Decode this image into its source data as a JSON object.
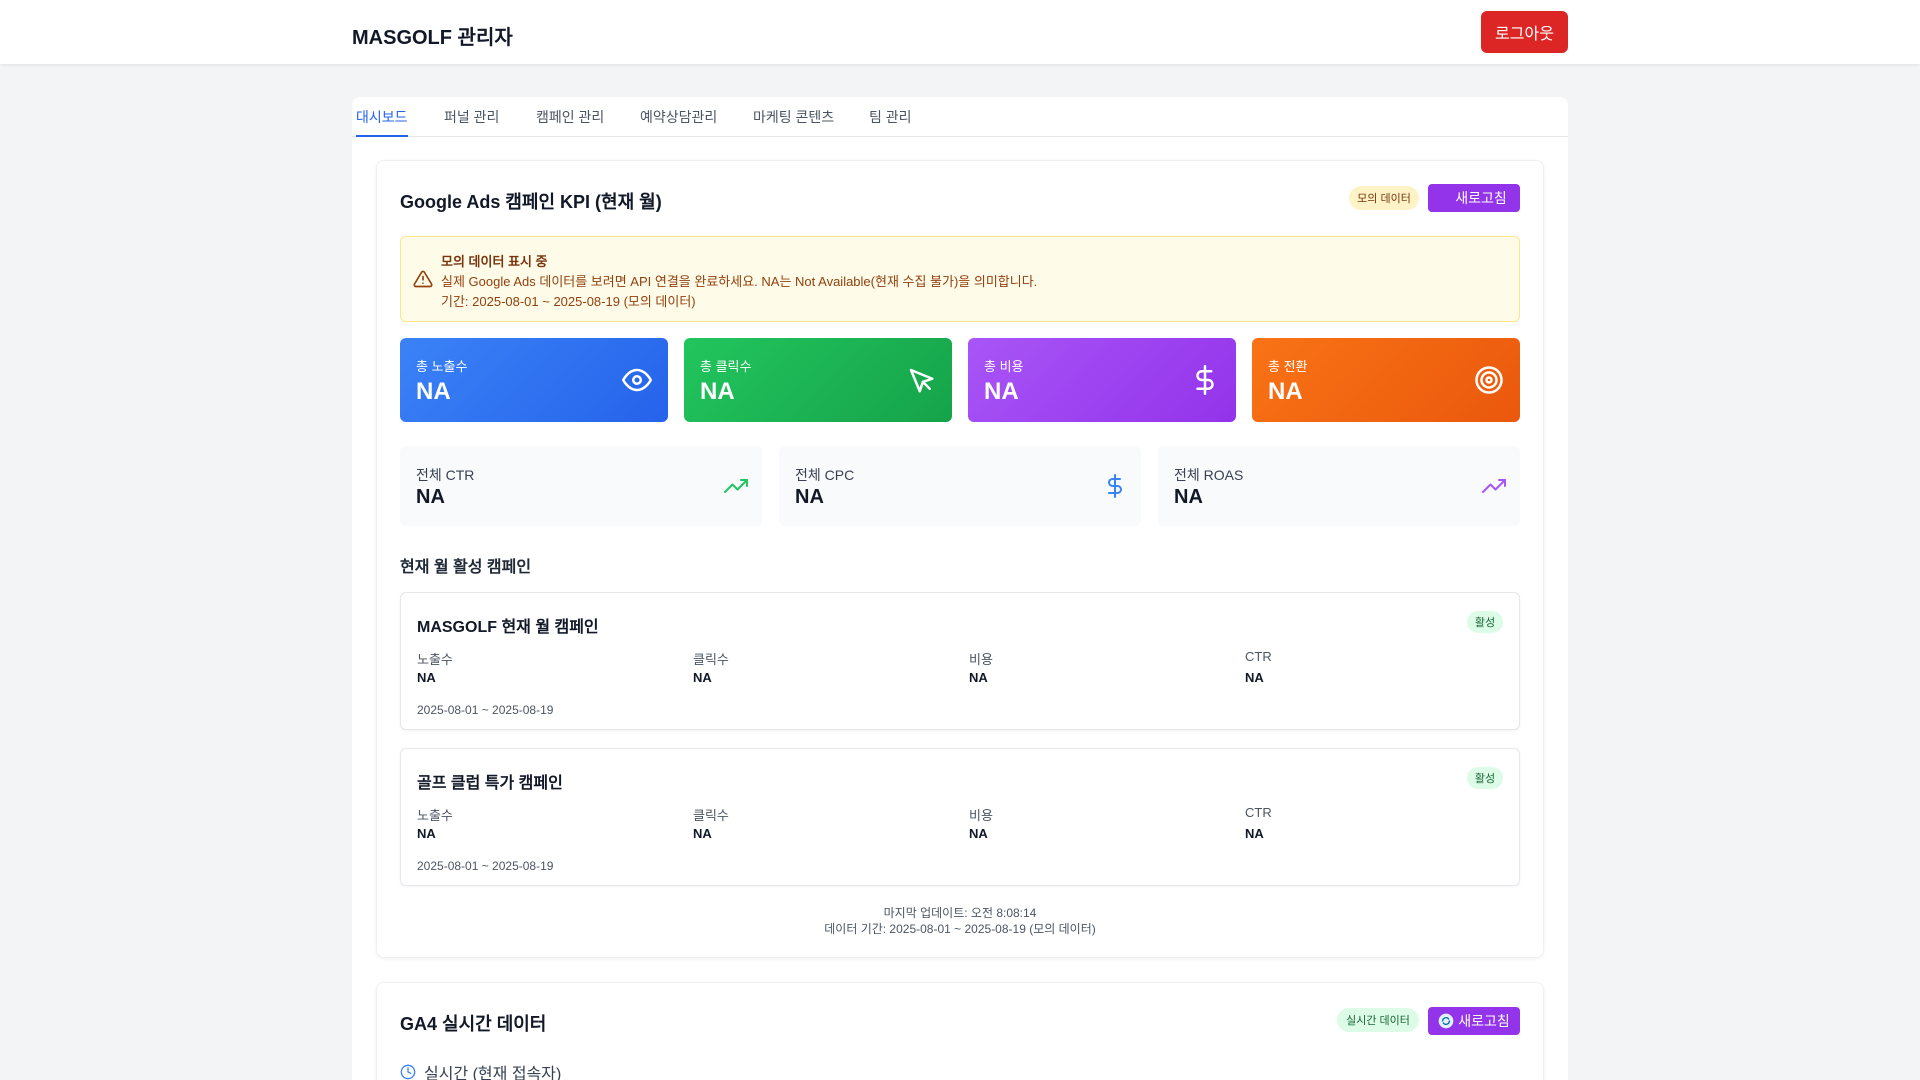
{
  "header": {
    "brand": "MASGOLF 관리자",
    "logout_label": "로그아웃"
  },
  "tabs": [
    {
      "label": "대시보드",
      "active": true
    },
    {
      "label": "퍼널 관리",
      "active": false
    },
    {
      "label": "캠페인 관리",
      "active": false
    },
    {
      "label": "예약상담관리",
      "active": false
    },
    {
      "label": "마케팅 콘텐츠",
      "active": false
    },
    {
      "label": "팀 관리",
      "active": false
    }
  ],
  "google_ads": {
    "title": "Google Ads 캠페인 KPI (현재 월)",
    "badge": "모의 데이터",
    "refresh_label": "새로고침",
    "alert": {
      "title": "모의 데이터 표시 중",
      "line1": "실제 Google Ads 데이터를 보려면 API 연결을 완료하세요. NA는 Not Available(현재 수집 불가)을 의미합니다.",
      "line2": "기간: 2025-08-01 ~ 2025-08-19 (모의 데이터)",
      "icon": "warning-triangle-icon"
    },
    "kpis": [
      {
        "label": "총 노출수",
        "value": "NA",
        "icon": "eye-icon",
        "color": "#3b82f6"
      },
      {
        "label": "총 클릭수",
        "value": "NA",
        "icon": "cursor-icon",
        "color": "#22c55e"
      },
      {
        "label": "총 비용",
        "value": "NA",
        "icon": "dollar-icon",
        "color": "#a855f7"
      },
      {
        "label": "총 전환",
        "value": "NA",
        "icon": "target-icon",
        "color": "#f97316"
      }
    ],
    "metrics": [
      {
        "label": "전체 CTR",
        "value": "NA",
        "icon": "trending-up-icon",
        "color": "#22c55e"
      },
      {
        "label": "전체 CPC",
        "value": "NA",
        "icon": "dollar-icon",
        "color": "#3b82f6"
      },
      {
        "label": "전체 ROAS",
        "value": "NA",
        "icon": "trending-up-icon",
        "color": "#a855f7"
      }
    ],
    "campaigns_title": "현재 월 활성 캠페인",
    "campaigns": [
      {
        "name": "MASGOLF 현재 월 캠페인",
        "status": "활성",
        "stats": [
          {
            "label": "노출수",
            "value": "NA"
          },
          {
            "label": "클릭수",
            "value": "NA"
          },
          {
            "label": "비용",
            "value": "NA"
          },
          {
            "label": "CTR",
            "value": "NA"
          }
        ],
        "dates": "2025-08-01 ~ 2025-08-19"
      },
      {
        "name": "골프 클럽 특가 캠페인",
        "status": "활성",
        "stats": [
          {
            "label": "노출수",
            "value": "NA"
          },
          {
            "label": "클릭수",
            "value": "NA"
          },
          {
            "label": "비용",
            "value": "NA"
          },
          {
            "label": "CTR",
            "value": "NA"
          }
        ],
        "dates": "2025-08-01 ~ 2025-08-19"
      }
    ],
    "last_updated": "마지막 업데이트: 오전 8:08:14",
    "data_period": "데이터 기간: 2025-08-01 ~ 2025-08-19 (모의 데이터)"
  },
  "ga4": {
    "title": "GA4 실시간 데이터",
    "badge": "실시간 데이터",
    "refresh_label": "새로고침",
    "realtime_label": "실시간 (현재 접속자)",
    "realtime_icon": "clock-icon"
  }
}
